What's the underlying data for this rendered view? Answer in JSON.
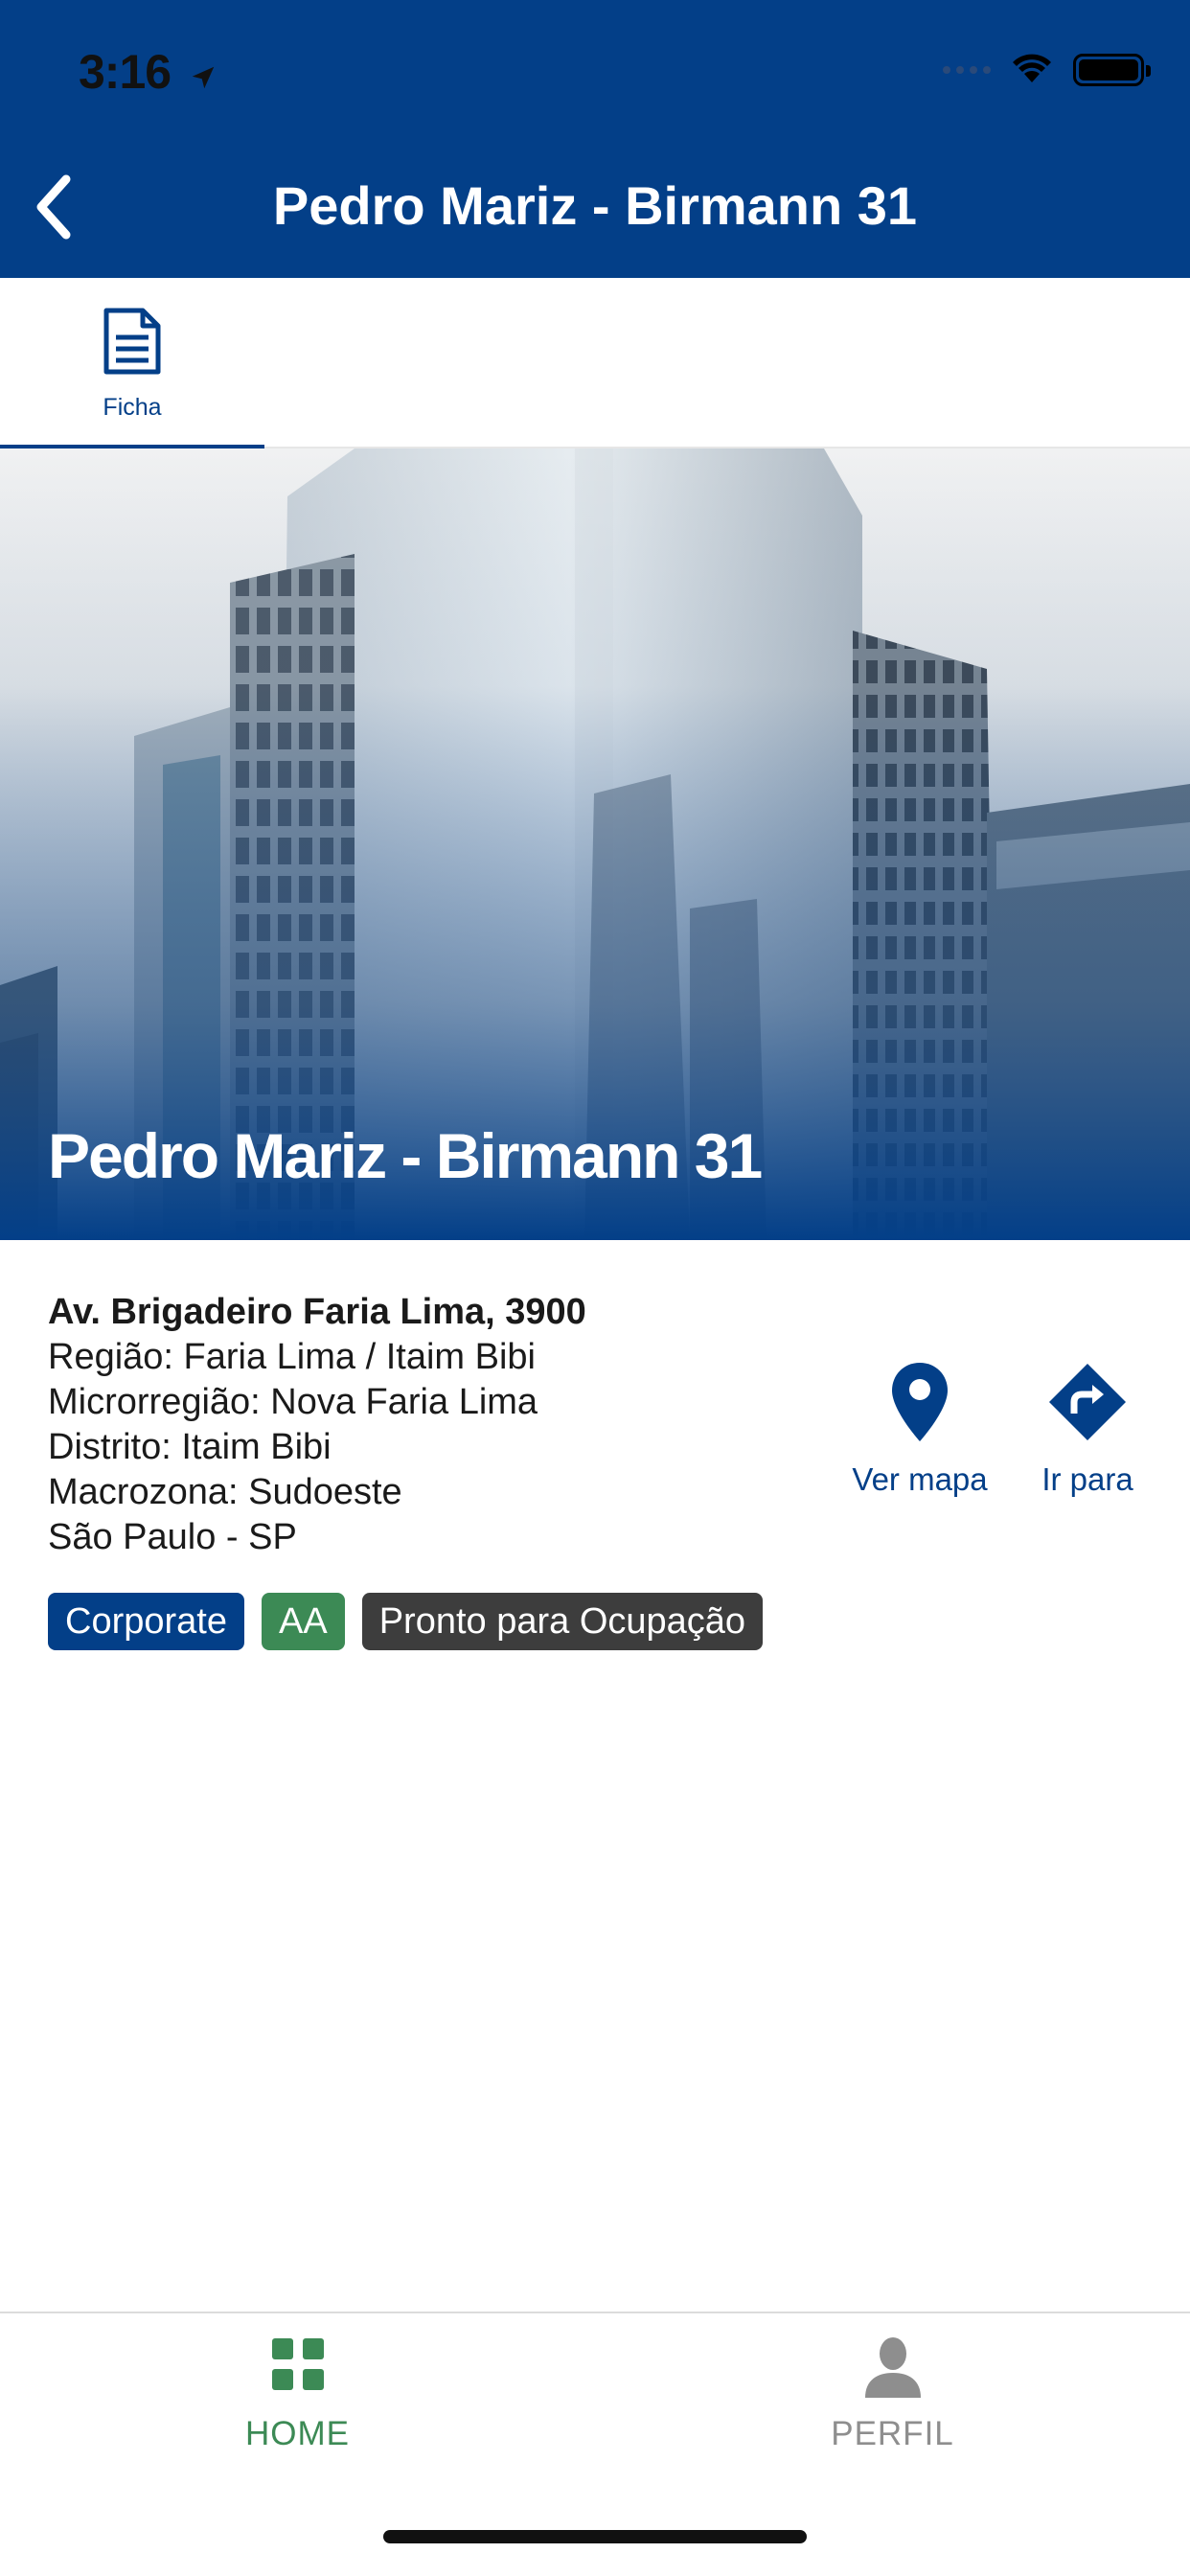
{
  "status_bar": {
    "time": "3:16"
  },
  "header": {
    "title": "Pedro Mariz - Birmann 31",
    "background_color": "#033F88"
  },
  "tabs": [
    {
      "label": "Ficha",
      "icon": "document-icon",
      "active": true
    }
  ],
  "hero": {
    "title": "Pedro Mariz - Birmann 31"
  },
  "building": {
    "address": "Av. Brigadeiro Faria Lima, 3900",
    "lines": [
      "Região: Faria Lima / Itaim Bibi",
      "Microrregião: Nova Faria Lima",
      "Distrito: Itaim Bibi",
      "Macrozona: Sudoeste",
      "São Paulo - SP"
    ]
  },
  "actions": {
    "map_label": "Ver mapa",
    "route_label": "Ir para"
  },
  "badges": [
    {
      "label": "Corporate",
      "color": "#033F88"
    },
    {
      "label": "AA",
      "color": "#3c8a55"
    },
    {
      "label": "Pronto para Ocupação",
      "color": "#3d3d3d"
    }
  ],
  "bottom_nav": {
    "home_label": "HOME",
    "profile_label": "PERFIL",
    "active_color": "#3c8a55",
    "inactive_color": "#8e8e8e"
  }
}
